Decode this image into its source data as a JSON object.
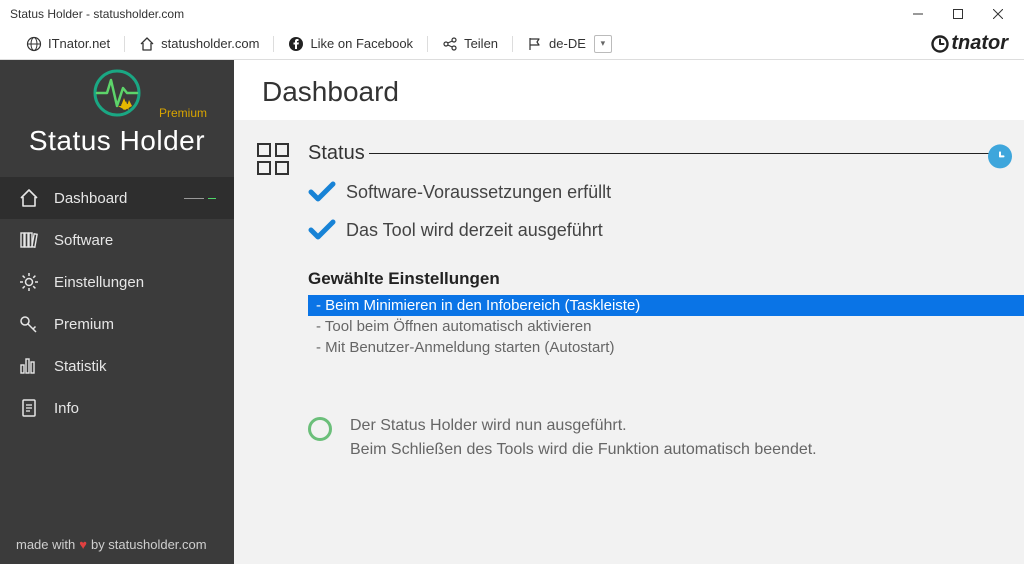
{
  "window": {
    "title": "Status Holder - statusholder.com"
  },
  "toolbar": {
    "itnator": "ITnator.net",
    "statusholder": "statusholder.com",
    "facebook": "Like on Facebook",
    "share": "Teilen",
    "lang": "de-DE",
    "brand": "tnator"
  },
  "sidebar": {
    "premium": "Premium",
    "app_name": "Status Holder",
    "items": [
      {
        "label": "Dashboard"
      },
      {
        "label": "Software"
      },
      {
        "label": "Einstellungen"
      },
      {
        "label": "Premium"
      },
      {
        "label": "Statistik"
      },
      {
        "label": "Info"
      }
    ],
    "footer_a": "made with",
    "footer_b": "by statusholder.com"
  },
  "main": {
    "title": "Dashboard",
    "status_label": "Status",
    "check1": "Software-Voraussetzungen erfüllt",
    "check2": "Das Tool wird derzeit ausgeführt",
    "settings_title": "Gewählte Einstellungen",
    "settings": [
      "- Beim Minimieren in den Infobereich (Taskleiste)",
      "- Tool beim Öffnen automatisch aktivieren",
      "- Mit Benutzer-Anmeldung starten (Autostart)"
    ],
    "running1": "Der Status Holder wird nun ausgeführt.",
    "running2": "Beim Schließen des Tools wird die Funktion automatisch beendet."
  }
}
